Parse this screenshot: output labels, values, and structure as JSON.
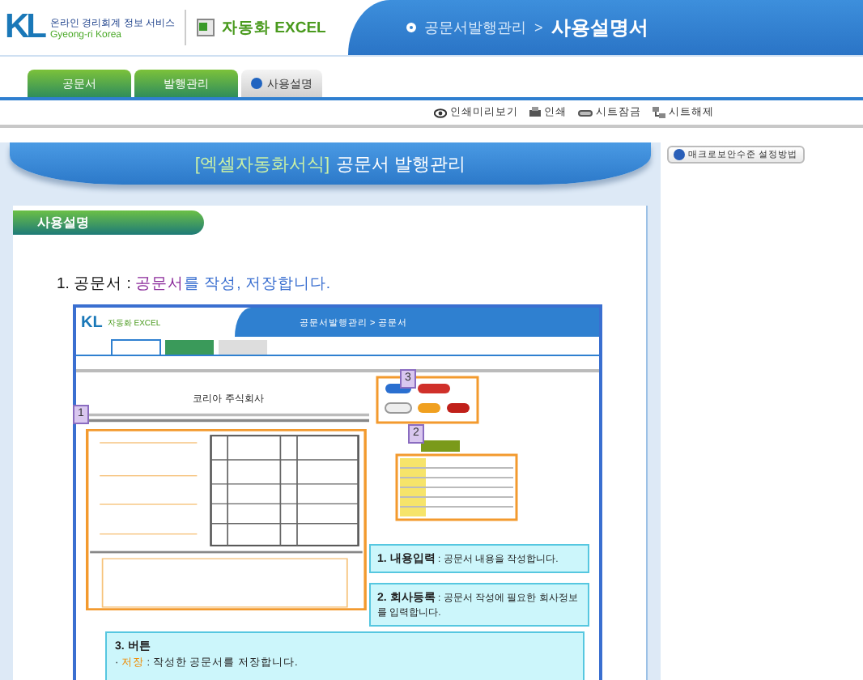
{
  "header": {
    "logo_mark": "KL",
    "logo_title": "온라인 경리회계 정보 서비스",
    "logo_subtitle": "Gyeong-ri Korea",
    "product": "자동화 EXCEL",
    "breadcrumb": "공문서발행관리",
    "separator": ">",
    "current_page": "사용설명서"
  },
  "tabs": [
    {
      "label": "공문서",
      "selected": false
    },
    {
      "label": "발행관리",
      "selected": false
    },
    {
      "label": "사용설명",
      "selected": true
    }
  ],
  "toolbar": [
    "인쇄미리보기",
    "인쇄",
    "시트잠금",
    "시트해제"
  ],
  "banner": {
    "prefix": "[엑셀자동화서식]",
    "title": "공문서 발행관리"
  },
  "section_title": "사용설명",
  "step": {
    "label": "1. 공문서 :",
    "term": "공문서",
    "rest": "를 작성, 저장합니다."
  },
  "preview": {
    "logo_mark": "KL",
    "product": "자동화 EXCEL",
    "breadcrumb": "공문서발행관리 > 공문서",
    "company": "코리아 주식회사",
    "markers": [
      "1",
      "2",
      "3"
    ],
    "notes": [
      {
        "title": "1. 내용입력",
        "colon": ":",
        "text": "공문서 내용을 작성합니다."
      },
      {
        "title": "2. 회사등록",
        "colon": ":",
        "text": "공문서 작성에 필요한 회사정보를 입력합니다."
      }
    ],
    "buttons_note": {
      "title": "3. 버튼",
      "items": [
        {
          "bullet": "·",
          "term": "저장",
          "colon": ":",
          "text": "작성한 공문서를 저장합니다."
        }
      ]
    }
  },
  "side_button": "매크로보안수준 설정방법"
}
